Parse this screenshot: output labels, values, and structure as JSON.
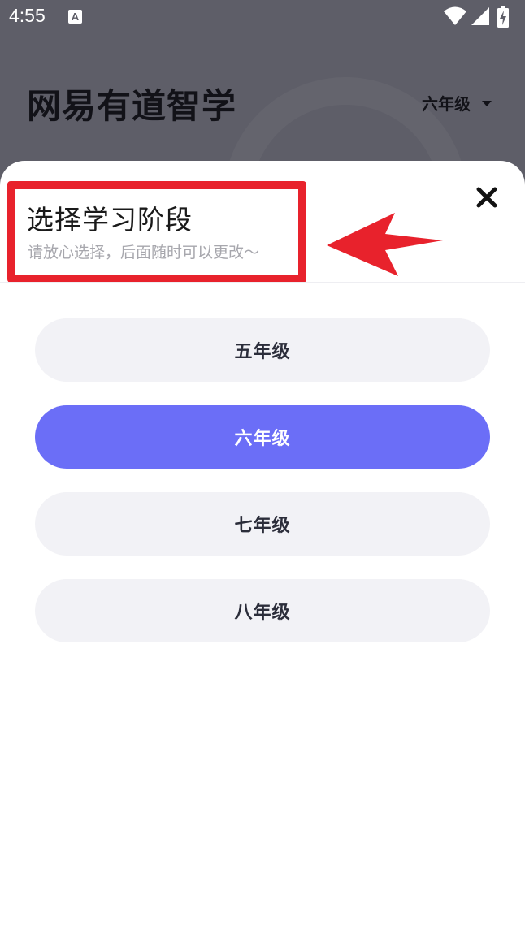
{
  "status_bar": {
    "time": "4:55",
    "notification_icon_letter": "A",
    "icons": [
      "wifi-icon",
      "cellular-signal-icon",
      "battery-charging-icon"
    ]
  },
  "background_app": {
    "title": "网易有道智学",
    "grade_selector": "六年级"
  },
  "sheet": {
    "title": "选择学习阶段",
    "subtitle": "请放心选择，后面随时可以更改～",
    "close_icon": "close-icon",
    "options": [
      {
        "label": "五年级",
        "selected": false
      },
      {
        "label": "六年级",
        "selected": true
      },
      {
        "label": "七年级",
        "selected": false
      },
      {
        "label": "八年级",
        "selected": false
      }
    ]
  },
  "annotation": {
    "highlight_color": "#e8222c",
    "arrow_color": "#e8222c"
  },
  "colors": {
    "accent": "#6b6ef7",
    "option_background": "#f2f2f6",
    "dim_overlay": "#5e5e68"
  }
}
